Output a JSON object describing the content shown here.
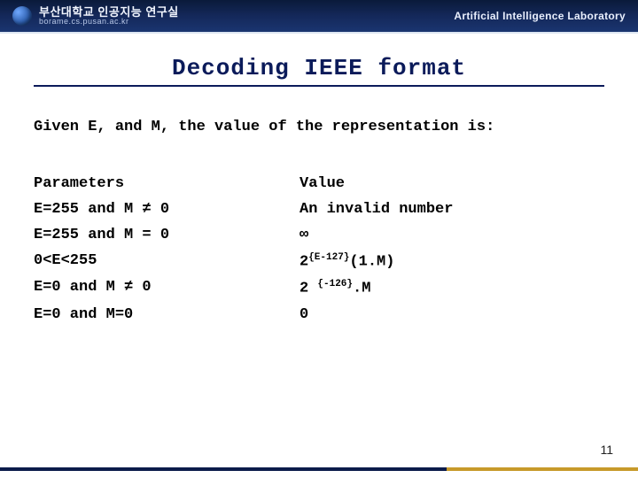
{
  "header": {
    "org_kr": "부산대학교 인공지능 연구실",
    "url": "borame.cs.pusan.ac.kr",
    "lab_en": "Artificial Intelligence Laboratory"
  },
  "slide": {
    "title": "Decoding IEEE format",
    "lead": "Given E, and M, the value of the representation is:",
    "col_headers": {
      "params": "Parameters",
      "value": "Value"
    },
    "rows": [
      {
        "param": "E=255 and M ≠ 0",
        "value_plain": "An invalid number"
      },
      {
        "param": "E=255 and M = 0",
        "value_plain": "∞"
      },
      {
        "param": "0<E<255",
        "value_base_a": "2",
        "value_exp_a": "{E-127}",
        "value_mid": "(1.M)"
      },
      {
        "param": "E=0 and M ≠ 0",
        "value_base_a": "2 ",
        "value_exp_a": "{-126}",
        "value_mid": ".M"
      },
      {
        "param": "E=0 and M=0",
        "value_plain": "0"
      }
    ],
    "page_number": "11"
  }
}
